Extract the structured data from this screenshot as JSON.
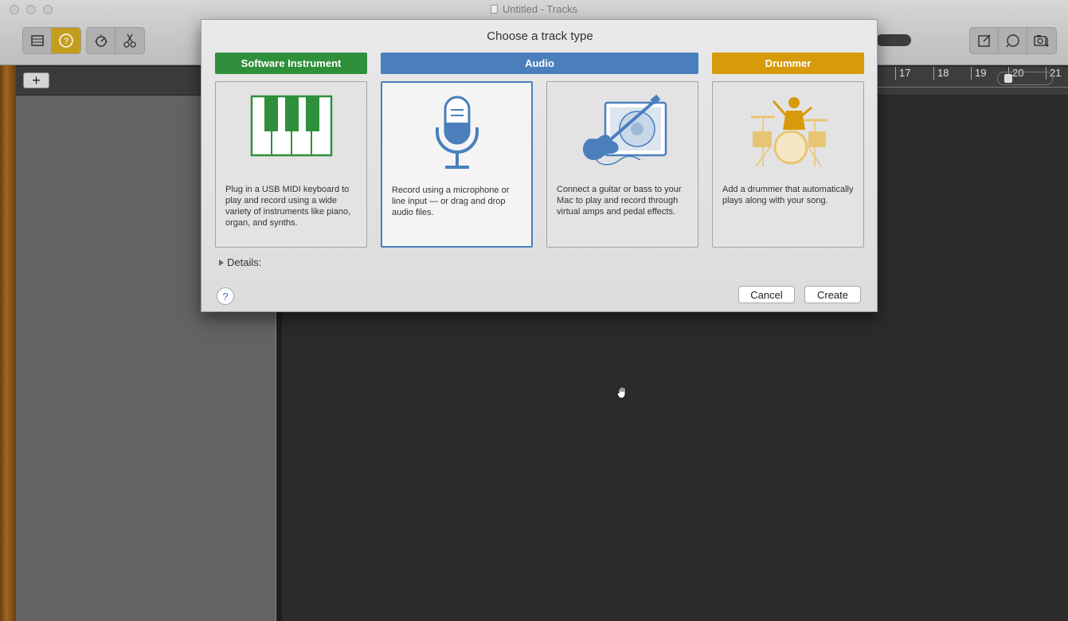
{
  "window": {
    "title": "Untitled - Tracks"
  },
  "toolbar": {
    "left_buttons": [
      "library-icon",
      "help-icon"
    ],
    "mid_buttons": [
      "smart-controls-icon",
      "scissors-icon"
    ],
    "right_buttons": [
      "notepad-icon",
      "loop-browser-icon",
      "media-browser-icon"
    ]
  },
  "track_header": {
    "add_label": "+"
  },
  "ruler": {
    "bars": [
      "17",
      "18",
      "19",
      "20",
      "21"
    ]
  },
  "dialog": {
    "title": "Choose a track type",
    "categories": [
      {
        "label": "Software Instrument",
        "color": "#2f8f3b"
      },
      {
        "label": "Audio",
        "color": "#4a7fbc"
      },
      {
        "label": "Drummer",
        "color": "#d79a0a"
      }
    ],
    "cards": [
      {
        "name": "software-instrument",
        "icon": "piano-keys-icon",
        "description": "Plug in a USB MIDI keyboard to play and record using a wide variety of instruments like piano, organ, and synths.",
        "selected": false
      },
      {
        "name": "audio-microphone",
        "icon": "microphone-icon",
        "description": "Record using a microphone or line input — or drag and drop audio files.",
        "selected": true
      },
      {
        "name": "audio-guitar",
        "icon": "guitar-amp-icon",
        "description": "Connect a guitar or bass to your Mac to play and record through virtual amps and pedal effects.",
        "selected": false
      },
      {
        "name": "drummer",
        "icon": "drummer-icon",
        "description": "Add a drummer that automatically plays along with your song.",
        "selected": false
      }
    ],
    "details_label": "Details:",
    "help_label": "?",
    "cancel_label": "Cancel",
    "create_label": "Create"
  }
}
